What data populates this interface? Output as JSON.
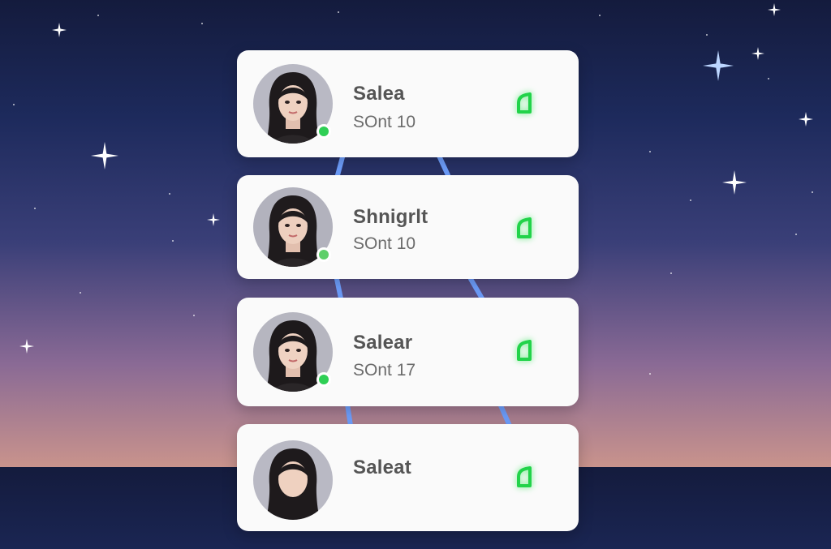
{
  "contacts": [
    {
      "name": "Salea",
      "sub": "SOnt 10",
      "status_color": "#22d34a"
    },
    {
      "name": "Shnigrlt",
      "sub": "SOnt 10",
      "status_color": "#22d34a"
    },
    {
      "name": "Salear",
      "sub": "SOnt 17",
      "status_color": "#22d34a"
    },
    {
      "name": "Saleat",
      "sub": "",
      "status_color": "#22d34a"
    }
  ],
  "icons": {
    "avatar": "avatar-portrait",
    "presence": "online-presence-dot",
    "status": "status-icon"
  },
  "colors": {
    "sky_top": "#141b3d",
    "sky_bottom": "#c9938c",
    "card": "#fafafa",
    "accent": "#22d34a"
  }
}
